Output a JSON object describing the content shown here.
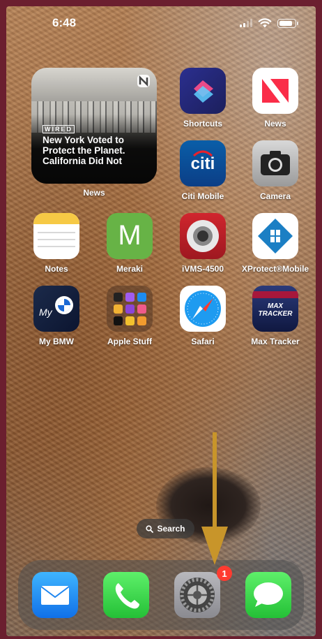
{
  "status": {
    "time": "6:48"
  },
  "widget": {
    "brand": "WIRED",
    "headline": "New York Voted to Protect the Planet. California Did Not",
    "label": "News"
  },
  "apps": [
    {
      "name": "shortcuts",
      "label": "Shortcuts",
      "icon": "shortcuts-icon"
    },
    {
      "name": "news",
      "label": "News",
      "icon": "news-icon"
    },
    {
      "name": "citi-mobile",
      "label": "Citi Mobile",
      "icon": "citi-icon",
      "icon_text": "citi"
    },
    {
      "name": "camera",
      "label": "Camera",
      "icon": "camera-icon"
    },
    {
      "name": "notes",
      "label": "Notes",
      "icon": "notes-icon"
    },
    {
      "name": "meraki",
      "label": "Meraki",
      "icon": "meraki-icon",
      "icon_text": "M"
    },
    {
      "name": "ivms",
      "label": "iVMS-4500",
      "icon": "ivms-icon"
    },
    {
      "name": "xprotect",
      "label": "XProtect®Mobile",
      "icon": "xprotect-icon"
    },
    {
      "name": "my-bmw",
      "label": "My BMW",
      "icon": "bmw-icon",
      "icon_text": "My"
    },
    {
      "name": "apple-stuff",
      "label": "Apple Stuff",
      "icon": "folder-icon"
    },
    {
      "name": "safari",
      "label": "Safari",
      "icon": "safari-icon"
    },
    {
      "name": "max-tracker",
      "label": "Max Tracker",
      "icon": "max-tracker-icon",
      "icon_text": "MAX TRACKER"
    }
  ],
  "search": {
    "label": "Search"
  },
  "dock": [
    {
      "name": "mail",
      "icon": "mail-icon"
    },
    {
      "name": "phone",
      "icon": "phone-icon"
    },
    {
      "name": "settings",
      "icon": "settings-icon",
      "badge": "1"
    },
    {
      "name": "messages",
      "icon": "messages-icon"
    }
  ],
  "colors": {
    "frame": "#6b1f2f",
    "annotation_arrow": "#c8952a",
    "badge": "#ff3b30"
  }
}
